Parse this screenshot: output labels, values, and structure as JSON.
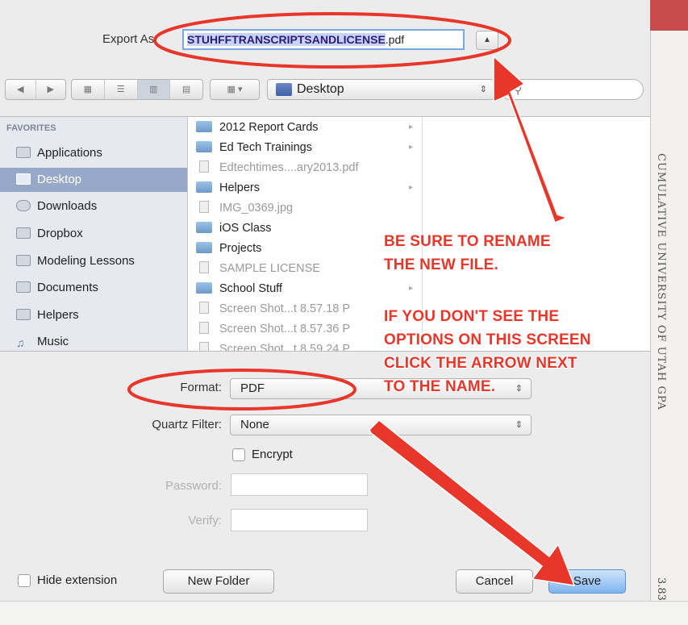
{
  "dialog": {
    "export_label": "Export As:",
    "filename_selected": "STUHFFTRANSCRIPTSANDLICENSE",
    "filename_ext": ".pdf",
    "expand_glyph": "▲"
  },
  "toolbar": {
    "back_glyph": "◀",
    "forward_glyph": "▶",
    "view_glyphs": [
      "▦",
      "☰",
      "▥",
      "▤"
    ],
    "arrange_glyph": "▦ ▾",
    "location": "Desktop",
    "location_arrow": "⇕",
    "search_glyph": "⚲"
  },
  "sidebar": {
    "heading": "FAVORITES",
    "items": [
      {
        "label": "Applications",
        "icon": "applications-icon"
      },
      {
        "label": "Desktop",
        "icon": "desktop-icon",
        "selected": true
      },
      {
        "label": "Downloads",
        "icon": "downloads-icon"
      },
      {
        "label": "Dropbox",
        "icon": "folder-icon"
      },
      {
        "label": "Modeling Lessons",
        "icon": "folder-icon"
      },
      {
        "label": "Documents",
        "icon": "documents-icon"
      },
      {
        "label": "Helpers",
        "icon": "folder-icon"
      },
      {
        "label": "Music",
        "icon": "music-icon"
      }
    ]
  },
  "files": [
    {
      "name": "2012 Report Cards",
      "type": "folder"
    },
    {
      "name": "Ed Tech Trainings",
      "type": "folder"
    },
    {
      "name": "Edtechtimes....ary2013.pdf",
      "type": "doc"
    },
    {
      "name": "Helpers",
      "type": "folder"
    },
    {
      "name": "IMG_0369.jpg",
      "type": "doc"
    },
    {
      "name": "iOS Class",
      "type": "folder"
    },
    {
      "name": "Projects",
      "type": "folder"
    },
    {
      "name": "SAMPLE LICENSE",
      "type": "doc"
    },
    {
      "name": "School Stuff",
      "type": "folder"
    },
    {
      "name": "Screen Shot...t 8.57.18 P",
      "type": "doc"
    },
    {
      "name": "Screen Shot...t 8.57.36 P",
      "type": "doc"
    },
    {
      "name": "Screen Shot...t 8.59.24 P",
      "type": "doc"
    }
  ],
  "options": {
    "format_label": "Format:",
    "format_value": "PDF",
    "quartz_label": "Quartz Filter:",
    "quartz_value": "None",
    "popup_arrow": "⇕",
    "encrypt_label": "Encrypt",
    "password_label": "Password:",
    "verify_label": "Verify:"
  },
  "buttons": {
    "hide_extension": "Hide extension",
    "new_folder": "New Folder",
    "cancel": "Cancel",
    "save": "Save"
  },
  "annotations": {
    "rename_line1": "BE SURE TO RENAME",
    "rename_line2": "THE NEW FILE.",
    "options_line1": "IF YOU DON'T SEE THE",
    "options_line2": "OPTIONS ON THIS SCREEN",
    "options_line3": "CLICK THE ARROW NEXT",
    "options_line4": "TO THE NAME.",
    "color": "#e8372a"
  },
  "background_document": {
    "vertical_text": "CUMULATIVE UNIVERSITY OF UTAH GPA",
    "value": "3.83"
  }
}
